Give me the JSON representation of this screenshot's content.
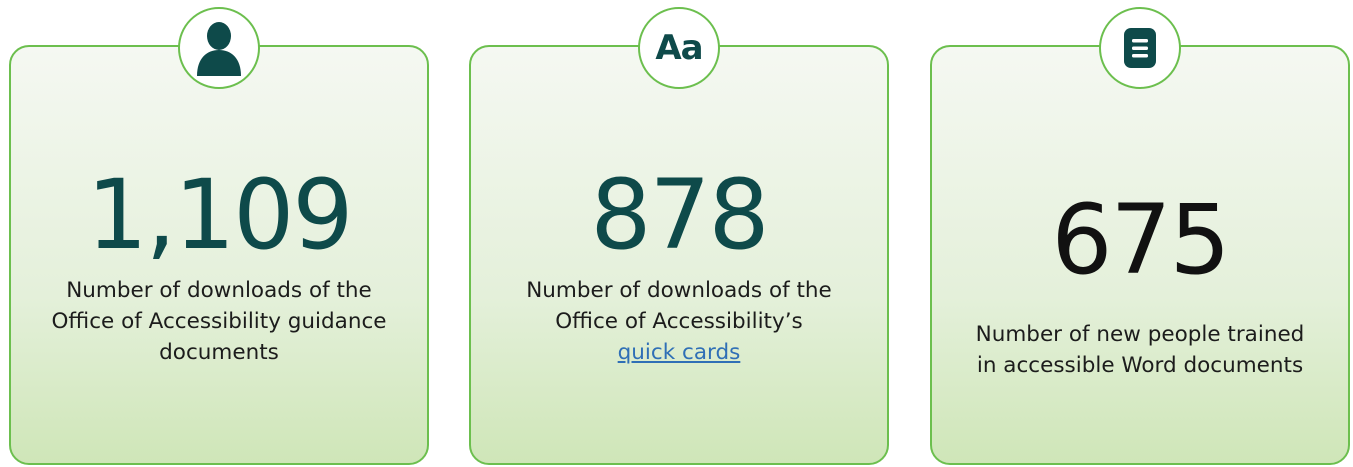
{
  "cards": [
    {
      "icon": "person-icon",
      "value": "1,109",
      "lines": [
        "Number of downloads of the",
        "Office of Accessibility guidance",
        "documents"
      ]
    },
    {
      "icon": "text-size-icon",
      "icon_text": "Aa",
      "value": "878",
      "lines": [
        "Number of downloads of the",
        "Office of Accessibility’s"
      ],
      "link_text": "quick cards"
    },
    {
      "icon": "document-icon",
      "value": "675",
      "lines": [
        "Number of new people trained",
        "in accessible Word documents"
      ]
    }
  ],
  "colors": {
    "accent_border": "#6cbf4e",
    "stat_teal": "#0e4a4a",
    "link": "#2f6fb6"
  }
}
